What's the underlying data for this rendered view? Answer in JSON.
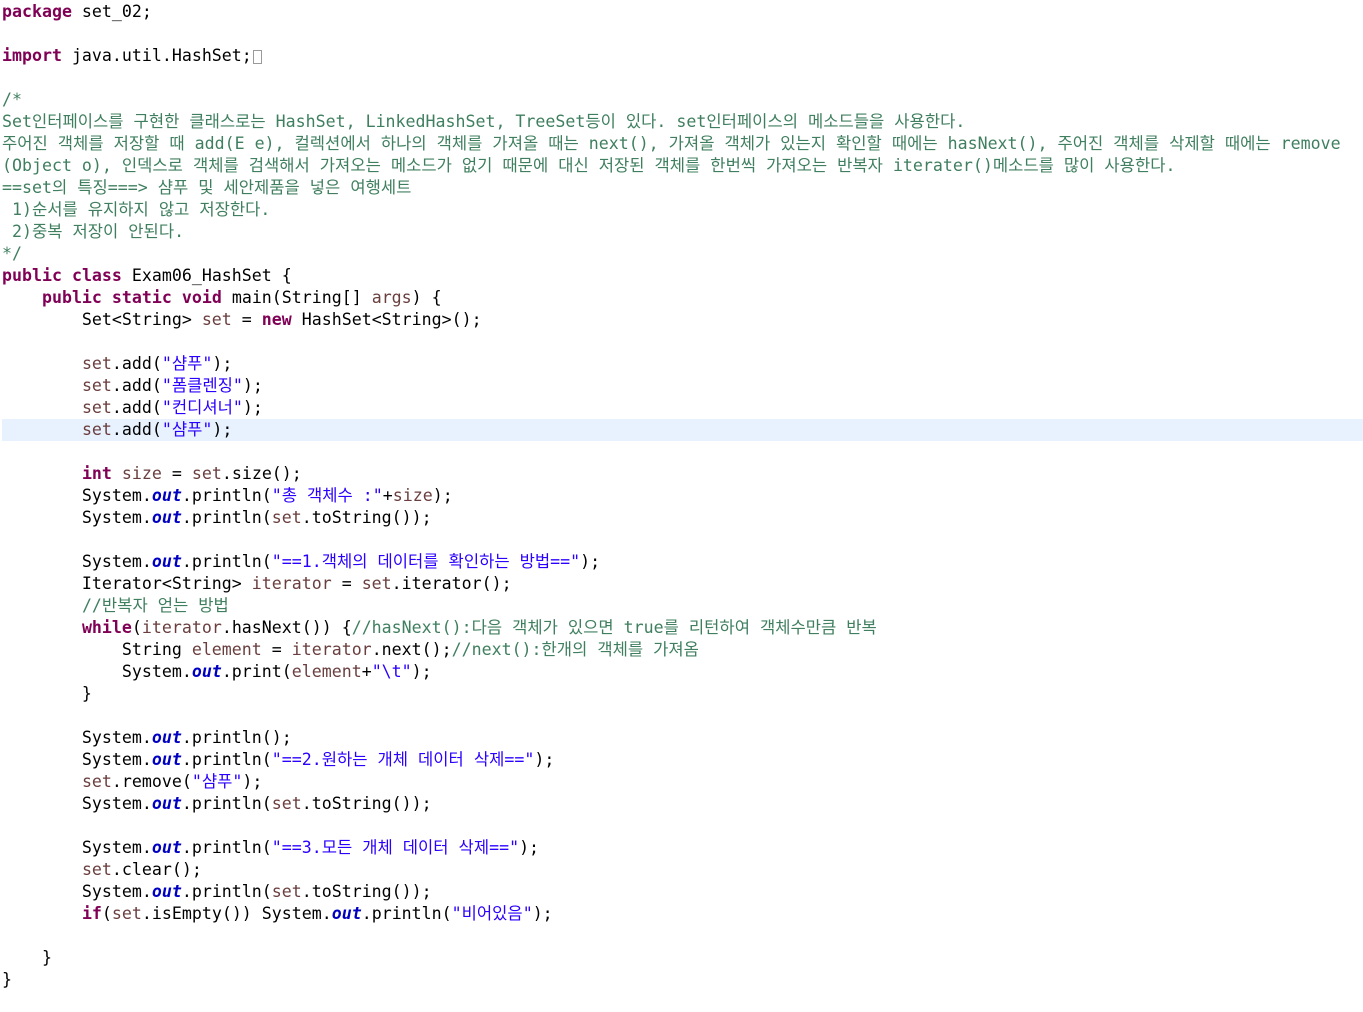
{
  "editor": {
    "language": "java",
    "lines": [
      [
        [
          "kw",
          "package"
        ],
        [
          "pl",
          " set_02;"
        ]
      ],
      [],
      [
        [
          "kw",
          "import"
        ],
        [
          "pl",
          " java.util.HashSet;"
        ],
        [
          "fold",
          ""
        ]
      ],
      [],
      [
        [
          "cm",
          "/*"
        ]
      ],
      [
        [
          "cm",
          "Set인터페이스를 구현한 클래스로는 HashSet, LinkedHashSet, TreeSet등이 있다. set인터페이스의 메소드들을 사용한다."
        ]
      ],
      [
        [
          "cm",
          "주어진 객체를 저장할 때 add(E e), 컬렉션에서 하나의 객체를 가져올 때는 next(), 가져올 객체가 있는지 확인할 때에는 hasNext(), 주어진 객체를 삭제할 때에는 remove"
        ]
      ],
      [
        [
          "cm",
          "(Object o), 인덱스로 객체를 검색해서 가져오는 메소드가 없기 때문에 대신 저장된 객체를 한번씩 가져오는 반복자 iterater()메소드를 많이 사용한다."
        ]
      ],
      [
        [
          "cm",
          "==set의 특징===> 샴푸 및 세안제품을 넣은 여행세트"
        ]
      ],
      [
        [
          "cm",
          " 1)순서를 유지하지 않고 저장한다."
        ]
      ],
      [
        [
          "cm",
          " 2)중복 저장이 안된다."
        ]
      ],
      [
        [
          "cm",
          "*/"
        ]
      ],
      [
        [
          "kw",
          "public"
        ],
        [
          "pl",
          " "
        ],
        [
          "kw",
          "class"
        ],
        [
          "pl",
          " Exam06_HashSet {"
        ]
      ],
      [
        [
          "pl",
          "    "
        ],
        [
          "kw",
          "public"
        ],
        [
          "pl",
          " "
        ],
        [
          "kw",
          "static"
        ],
        [
          "pl",
          " "
        ],
        [
          "kw",
          "void"
        ],
        [
          "pl",
          " main(String[] "
        ],
        [
          "var",
          "args"
        ],
        [
          "pl",
          ") {"
        ]
      ],
      [
        [
          "pl",
          "        Set<String> "
        ],
        [
          "var",
          "set"
        ],
        [
          "pl",
          " = "
        ],
        [
          "kw",
          "new"
        ],
        [
          "pl",
          " HashSet<String>();"
        ]
      ],
      [],
      [
        [
          "pl",
          "        "
        ],
        [
          "var",
          "set"
        ],
        [
          "pl",
          ".add("
        ],
        [
          "str",
          "\"샴푸\""
        ],
        [
          "pl",
          ");"
        ]
      ],
      [
        [
          "pl",
          "        "
        ],
        [
          "var",
          "set"
        ],
        [
          "pl",
          ".add("
        ],
        [
          "str",
          "\"폼클렌징\""
        ],
        [
          "pl",
          ");"
        ]
      ],
      [
        [
          "pl",
          "        "
        ],
        [
          "var",
          "set"
        ],
        [
          "pl",
          ".add("
        ],
        [
          "str",
          "\"컨디셔너\""
        ],
        [
          "pl",
          ");"
        ]
      ],
      [
        [
          "pl",
          "        "
        ],
        [
          "var",
          "set"
        ],
        [
          "pl",
          ".add("
        ],
        [
          "str",
          "\"샴푸\""
        ],
        [
          "pl",
          ");"
        ]
      ],
      [],
      [
        [
          "pl",
          "        "
        ],
        [
          "kw",
          "int"
        ],
        [
          "pl",
          " "
        ],
        [
          "var",
          "size"
        ],
        [
          "pl",
          " = "
        ],
        [
          "var",
          "set"
        ],
        [
          "pl",
          ".size();"
        ]
      ],
      [
        [
          "pl",
          "        System."
        ],
        [
          "fld",
          "out"
        ],
        [
          "pl",
          ".println("
        ],
        [
          "str",
          "\"총 객체수 :\""
        ],
        [
          "pl",
          "+"
        ],
        [
          "var",
          "size"
        ],
        [
          "pl",
          ");"
        ]
      ],
      [
        [
          "pl",
          "        System."
        ],
        [
          "fld",
          "out"
        ],
        [
          "pl",
          ".println("
        ],
        [
          "var",
          "set"
        ],
        [
          "pl",
          ".toString());"
        ]
      ],
      [],
      [
        [
          "pl",
          "        System."
        ],
        [
          "fld",
          "out"
        ],
        [
          "pl",
          ".println("
        ],
        [
          "str",
          "\"==1.객체의 데이터를 확인하는 방법==\""
        ],
        [
          "pl",
          ");"
        ]
      ],
      [
        [
          "pl",
          "        Iterator<String> "
        ],
        [
          "var",
          "iterator"
        ],
        [
          "pl",
          " = "
        ],
        [
          "var",
          "set"
        ],
        [
          "pl",
          ".iterator();"
        ]
      ],
      [
        [
          "pl",
          "        "
        ],
        [
          "cm",
          "//반복자 얻는 방법"
        ]
      ],
      [
        [
          "pl",
          "        "
        ],
        [
          "kw",
          "while"
        ],
        [
          "pl",
          "("
        ],
        [
          "var",
          "iterator"
        ],
        [
          "pl",
          ".hasNext()) {"
        ],
        [
          "cm",
          "//hasNext():다음 객체가 있으면 true를 리턴하여 객체수만큼 반복"
        ]
      ],
      [
        [
          "pl",
          "            String "
        ],
        [
          "var",
          "element"
        ],
        [
          "pl",
          " = "
        ],
        [
          "var",
          "iterator"
        ],
        [
          "pl",
          ".next();"
        ],
        [
          "cm",
          "//next():한개의 객체를 가져옴"
        ]
      ],
      [
        [
          "pl",
          "            System."
        ],
        [
          "fld",
          "out"
        ],
        [
          "pl",
          ".print("
        ],
        [
          "var",
          "element"
        ],
        [
          "pl",
          "+"
        ],
        [
          "str",
          "\"\\t\""
        ],
        [
          "pl",
          ");"
        ]
      ],
      [
        [
          "pl",
          "        }"
        ]
      ],
      [],
      [
        [
          "pl",
          "        System."
        ],
        [
          "fld",
          "out"
        ],
        [
          "pl",
          ".println();"
        ]
      ],
      [
        [
          "pl",
          "        System."
        ],
        [
          "fld",
          "out"
        ],
        [
          "pl",
          ".println("
        ],
        [
          "str",
          "\"==2.원하는 개체 데이터 삭제==\""
        ],
        [
          "pl",
          ");"
        ]
      ],
      [
        [
          "pl",
          "        "
        ],
        [
          "var",
          "set"
        ],
        [
          "pl",
          ".remove("
        ],
        [
          "str",
          "\"샴푸\""
        ],
        [
          "pl",
          ");"
        ]
      ],
      [
        [
          "pl",
          "        System."
        ],
        [
          "fld",
          "out"
        ],
        [
          "pl",
          ".println("
        ],
        [
          "var",
          "set"
        ],
        [
          "pl",
          ".toString());"
        ]
      ],
      [],
      [
        [
          "pl",
          "        System."
        ],
        [
          "fld",
          "out"
        ],
        [
          "pl",
          ".println("
        ],
        [
          "str",
          "\"==3.모든 개체 데이터 삭제==\""
        ],
        [
          "pl",
          ");"
        ]
      ],
      [
        [
          "pl",
          "        "
        ],
        [
          "var",
          "set"
        ],
        [
          "pl",
          ".clear();"
        ]
      ],
      [
        [
          "pl",
          "        System."
        ],
        [
          "fld",
          "out"
        ],
        [
          "pl",
          ".println("
        ],
        [
          "var",
          "set"
        ],
        [
          "pl",
          ".toString());"
        ]
      ],
      [
        [
          "pl",
          "        "
        ],
        [
          "kw",
          "if"
        ],
        [
          "pl",
          "("
        ],
        [
          "var",
          "set"
        ],
        [
          "pl",
          ".isEmpty()) System."
        ],
        [
          "fld",
          "out"
        ],
        [
          "pl",
          ".println("
        ],
        [
          "str",
          "\"비어있음\""
        ],
        [
          "pl",
          ");"
        ]
      ],
      [],
      [
        [
          "pl",
          "    }"
        ]
      ],
      [
        [
          "pl",
          "}"
        ]
      ]
    ],
    "current_line": 20,
    "colors": {
      "keyword": "#7f0055",
      "comment": "#3f7f5f",
      "string": "#2a00ff",
      "static_field": "#0000c0",
      "local_variable": "#6a3e3e",
      "plain": "#000000",
      "current_line_highlight": "#e8f2fe"
    }
  }
}
